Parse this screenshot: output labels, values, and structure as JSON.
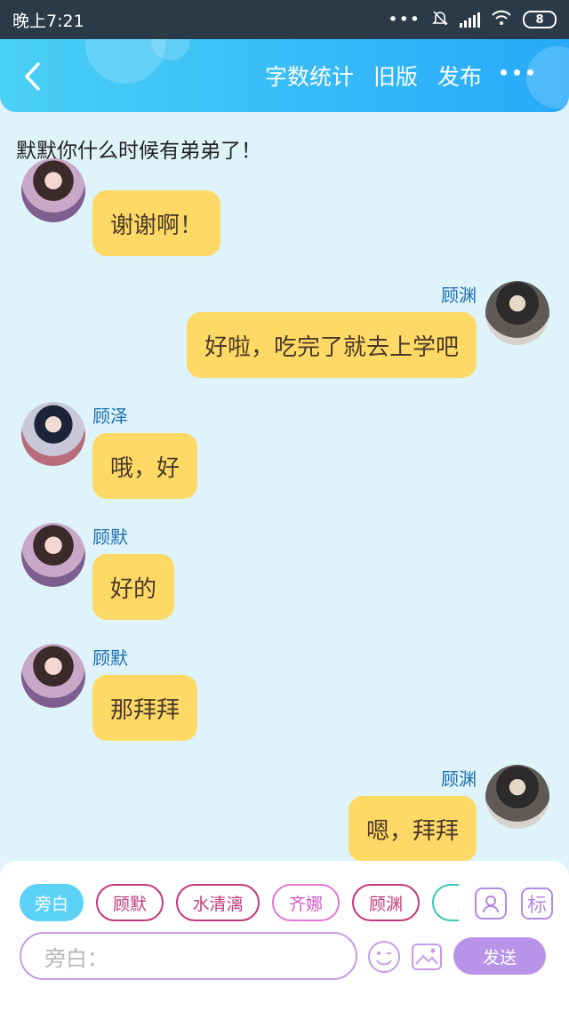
{
  "status_bar": {
    "time": "晚上7:21",
    "battery": "8"
  },
  "header": {
    "back_icon": "chevron-left-icon",
    "nav": [
      "字数统计",
      "旧版",
      "发布"
    ],
    "more_icon": "more-dots-icon"
  },
  "notice": "默默你什么时候有弟弟了！",
  "messages": [
    {
      "side": "left",
      "avatar": "girl",
      "name": "",
      "text": "谢谢啊！"
    },
    {
      "side": "right",
      "avatar": "boy",
      "name": "顾渊",
      "text": "好啦，吃完了就去上学吧"
    },
    {
      "side": "left",
      "avatar": "ze",
      "name": "顾泽",
      "text": "哦，好"
    },
    {
      "side": "left",
      "avatar": "girl",
      "name": "顾默",
      "text": "好的"
    },
    {
      "side": "left",
      "avatar": "girl",
      "name": "顾默",
      "text": "那拜拜"
    },
    {
      "side": "right",
      "avatar": "boy",
      "name": "顾渊",
      "text": "嗯，拜拜"
    }
  ],
  "composer": {
    "tags": [
      "旁白",
      "顾默",
      "水清漓",
      "齐娜",
      "顾渊",
      "王"
    ],
    "role_icon": "role-card-icon",
    "mark_label": "标",
    "input_placeholder": "旁白：",
    "emoji_icon": "smiley-icon",
    "image_icon": "image-icon",
    "send_label": "发送"
  },
  "colors": {
    "accent": "#27a9f8",
    "bubble": "#ffd966",
    "send": "#b894e8",
    "name": "#1f6fae"
  }
}
